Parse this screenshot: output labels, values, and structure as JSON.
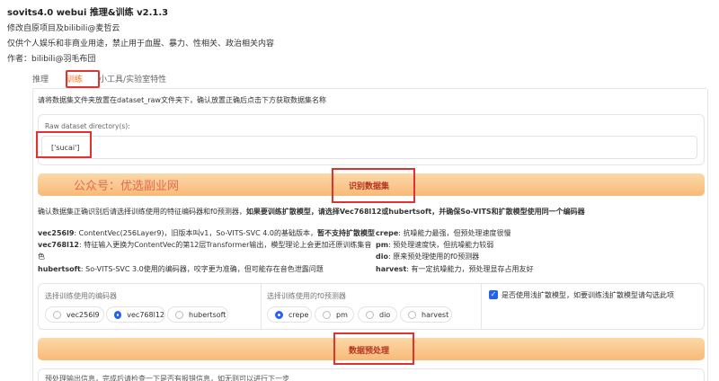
{
  "header": {
    "title": "sovits4.0 webui 推理&训练 v2.1.3",
    "line1": "修改自原项目及bilibili@麦哲云",
    "line2": "仅供个人娱乐和非商业用途，禁止用于血腥、暴力、性相关、政治相关内容",
    "line3": "作者：bilibili@羽毛布団"
  },
  "tabs": [
    {
      "label": "推理"
    },
    {
      "label": "训练"
    },
    {
      "label": "小工具/实验室特性"
    }
  ],
  "dataset": {
    "instruction": "请将数据集文件夹放置在dataset_raw文件夹下，确认放置正确后点击下方获取数据集名称",
    "raw_label": "Raw dataset directory(s):",
    "raw_value": "['sucai']",
    "identify_button": "识别数据集",
    "watermark": "公众号：优选副业网"
  },
  "encoder_info": {
    "confirm_prefix": "确认数据集正确识别后请选择训练使用的特征编码器和f0预测器，",
    "confirm_bold": "如果要训练扩散模型，请选择Vec768l12或hubertsoft，并确保So-VITS和扩散模型使用同一个编码器",
    "left": [
      {
        "name": "vec256l9",
        "desc": ": ContentVec(256Layer9)，旧版本叫v1，So-VITS-SVC 4.0的基础版本，",
        "bold": "暂不支持扩散模型"
      },
      {
        "name": "vec768l12",
        "desc": ": 特征输入更换为ContentVec的第12层Transformer输出，模型理论上会更加还原训练集音",
        "bold": ""
      },
      {
        "name": "",
        "desc": "色",
        "bold": ""
      },
      {
        "name": "hubertsoft",
        "desc": ": So-VITS-SVC 3.0使用的编码器，咬字更为准确，但可能存在音色泄露问题",
        "bold": ""
      }
    ],
    "right": [
      {
        "name": "crepe",
        "desc": ": 抗噪能力最强，但预处理速度很慢"
      },
      {
        "name": "pm",
        "desc": ": 预处理速度快，但抗噪能力较弱"
      },
      {
        "name": "dio",
        "desc": ": 原来预处理使用的f0预测器"
      },
      {
        "name": "harvest",
        "desc": ": 有一定抗噪能力，预处理显存占用友好"
      }
    ]
  },
  "encoder_select": {
    "label": "选择训练使用的编码器",
    "options": [
      "vec256l9",
      "vec768l12",
      "hubertsoft"
    ],
    "selected": "vec768l12"
  },
  "f0_select": {
    "label": "选择训练使用的f0预测器",
    "options": [
      "crepe",
      "pm",
      "dio",
      "harvest"
    ],
    "selected": "crepe"
  },
  "shallow_diffusion": {
    "label": "是否使用浅扩散模型，如要训练浅扩散模型请勾选此项",
    "checked": true
  },
  "preprocess_button": "数据预处理",
  "preprocess_info": "预处理输出信息，完成后请检查一下是否有报错信息，如无则可以进行下一步"
}
